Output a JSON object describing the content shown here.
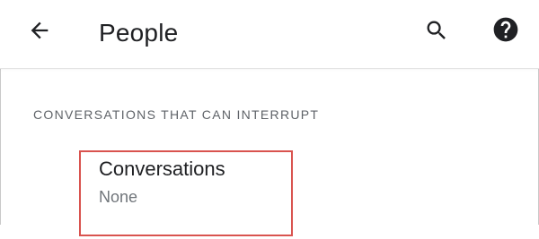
{
  "app_bar": {
    "back_icon": "arrow-left-icon",
    "title": "People",
    "search_icon": "search-icon",
    "help_icon": "help-circle-icon"
  },
  "section": {
    "header": "CONVERSATIONS THAT CAN INTERRUPT"
  },
  "preference": {
    "title": "Conversations",
    "summary": "None"
  },
  "colors": {
    "text_primary": "#202124",
    "text_secondary": "#70757a",
    "highlight_border": "#d9534f",
    "divider": "#e3e3e3"
  }
}
